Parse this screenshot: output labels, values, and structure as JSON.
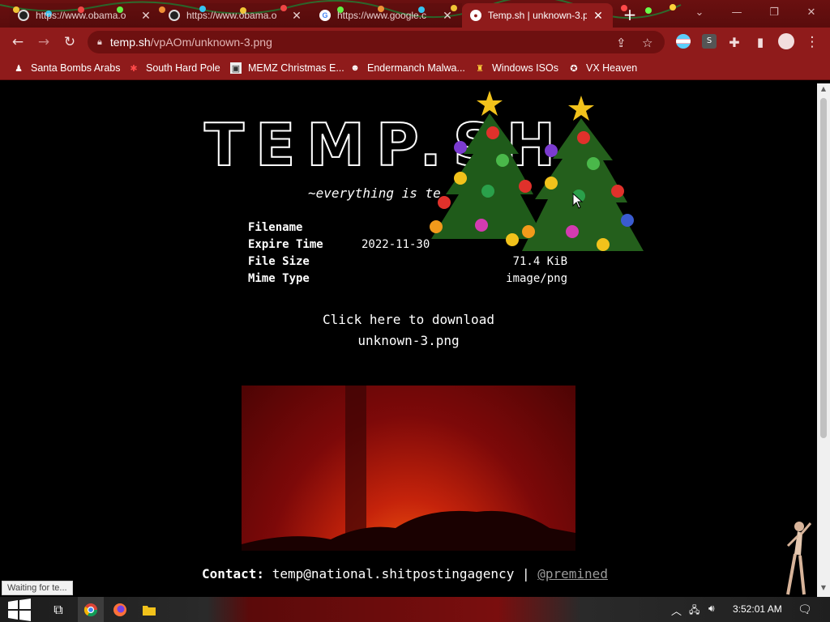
{
  "browser": {
    "tabs": [
      {
        "title": "https://www.obama.o",
        "favicon": "obama-favicon"
      },
      {
        "title": "https://www.obama.o",
        "favicon": "obama-favicon"
      },
      {
        "title": "https://www.google.c",
        "favicon": "google-favicon"
      },
      {
        "title": "Temp.sh | unknown-3.p",
        "favicon": "temp-favicon",
        "active": true
      }
    ],
    "new_tab_icon": "+",
    "url_host": "temp.sh",
    "url_path": "/vpAOm/unknown-3.png",
    "bookmarks": [
      {
        "label": "Santa Bombs Arabs"
      },
      {
        "label": "South Hard Pole"
      },
      {
        "label": "MEMZ Christmas E..."
      },
      {
        "label": "Endermanch Malwa..."
      },
      {
        "label": "Windows ISOs"
      },
      {
        "label": "VX Heaven"
      }
    ],
    "status_text": "Waiting for te..."
  },
  "page": {
    "logo": "TEMP.SH",
    "tagline": "~everything is te",
    "info": [
      {
        "key": "Filename",
        "value": ""
      },
      {
        "key": "Expire Time",
        "value": "2022-11-30"
      },
      {
        "key": "File Size",
        "value": "71.4 KiB"
      },
      {
        "key": "Mime Type",
        "value": "image/png"
      }
    ],
    "download_line1": "Click here to download",
    "download_line2": "unknown-3.png",
    "contact_label": "Contact:",
    "contact_email": "temp@national.shitpostingagency",
    "contact_sep": "|",
    "contact_handle": "@premined"
  },
  "taskbar": {
    "clock": "3:52:01 AM"
  },
  "colors": {
    "chrome_red": "#8f1b1b",
    "tabstrip": "#5a0c0c",
    "page_bg": "#000000"
  }
}
